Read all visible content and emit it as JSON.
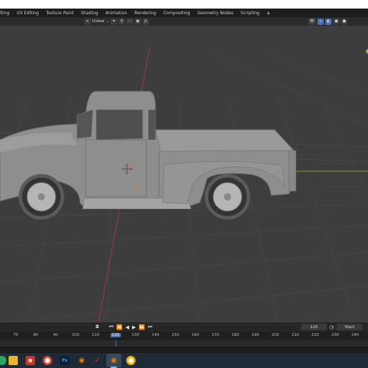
{
  "workspace_tabs": [
    "lting",
    "UV Editing",
    "Texture Paint",
    "Shading",
    "Animation",
    "Rendering",
    "Compositing",
    "Geometry Nodes",
    "Scripting"
  ],
  "add_workspace_label": "+",
  "header": {
    "transform_orientation": "Global"
  },
  "timeline": {
    "current_frame": "120",
    "start_label": "Start",
    "ruler_ticks": [
      "70",
      "80",
      "90",
      "100",
      "110",
      "120",
      "130",
      "140",
      "150",
      "160",
      "170",
      "180",
      "190",
      "200",
      "210",
      "220",
      "230",
      "240"
    ],
    "current_tick": "120"
  },
  "taskbar": {
    "apps": [
      "start-icon",
      "file-explorer-icon",
      "app-grid-icon",
      "chrome-icon",
      "photoshop-icon",
      "blender-icon",
      "red-app-icon",
      "blender-active-icon",
      "chrome-alt-icon"
    ],
    "photoshop_label": "Ps"
  },
  "colors": {
    "viewport_bg": "#3d3d3d",
    "grid_line": "#4a4a4a",
    "axis_red": "#a13a4a",
    "axis_green": "#7a9a2a",
    "truck_body": "#8e8e8e",
    "frame_highlight": "#4772b3"
  }
}
